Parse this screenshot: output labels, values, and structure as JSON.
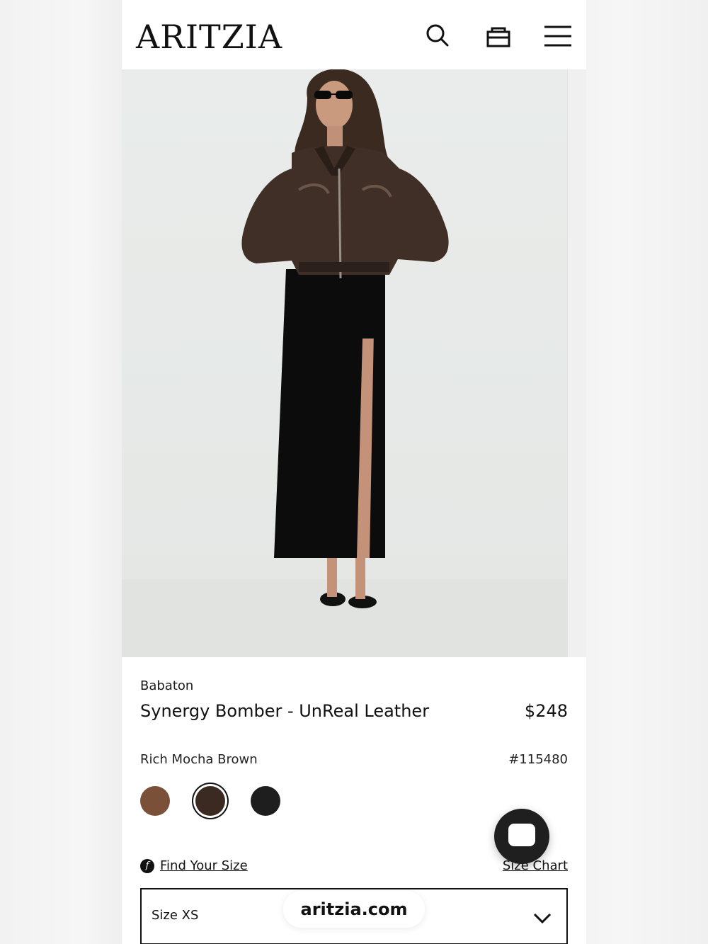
{
  "header": {
    "logo": "ARITZIA",
    "icons": [
      "search-icon",
      "bag-icon",
      "menu-icon"
    ]
  },
  "product": {
    "brand": "Babaton",
    "name": "Synergy Bomber - UnReal Leather",
    "price": "$248",
    "color_name": "Rich Mocha Brown",
    "style_number": "#115480",
    "swatches": [
      {
        "color": "#7a5038",
        "selected": false
      },
      {
        "color": "#3b2a22",
        "selected": true
      },
      {
        "color": "#1e1e1e",
        "selected": false
      }
    ],
    "find_size_label": "Find Your Size",
    "size_chart_label": "Size Chart",
    "size_value": "Size XS"
  },
  "browser": {
    "url": "aritzia.com"
  },
  "colors": {
    "accent": "#111111",
    "jacket": "#3f2f27",
    "skirt": "#0c0c0c",
    "background": "#e8ebe9"
  }
}
